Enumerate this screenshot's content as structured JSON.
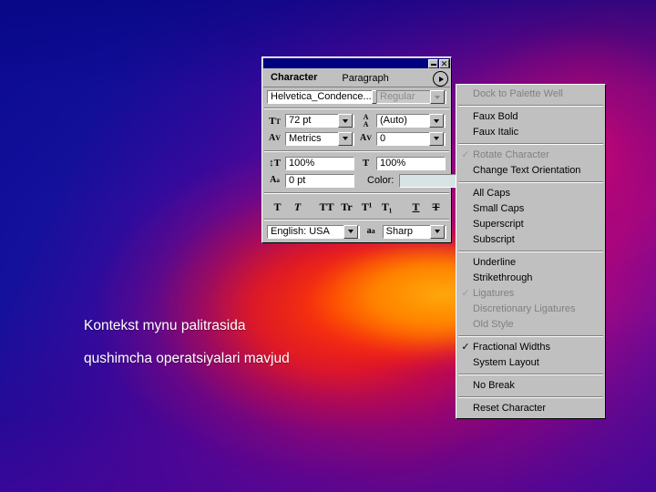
{
  "slide": {
    "line1": "Kontekst mynu palitrasida",
    "line2": "qushimcha operatsiyalari mavjud"
  },
  "palette": {
    "titlebar": {
      "minimize_label": "",
      "close_label": "✕"
    },
    "tabs": [
      {
        "label": "Character",
        "active": true
      },
      {
        "label": "Paragraph",
        "active": false
      }
    ],
    "menu_button": "palette-menu-triangle",
    "font": {
      "family_value": "Helvetica_Condence...",
      "style_value": "Regular",
      "style_disabled": true
    },
    "size": {
      "icon": "font-size-icon",
      "value": "72 pt"
    },
    "leading": {
      "icon": "leading-icon",
      "value": "(Auto)"
    },
    "kerning": {
      "icon": "kerning-icon",
      "value": "Metrics"
    },
    "tracking": {
      "icon": "tracking-icon",
      "value": "0"
    },
    "vertical_scale": {
      "icon": "vertical-scale-icon",
      "value": "100%"
    },
    "horizontal_scale": {
      "icon": "horizontal-scale-icon",
      "value": "100%"
    },
    "baseline_shift": {
      "icon": "baseline-shift-icon",
      "value": "0 pt"
    },
    "color": {
      "label": "Color:",
      "swatch_hex": "#d8e4e4"
    },
    "style_buttons": [
      {
        "name": "faux-bold-button",
        "glyph": "T",
        "style": "bold"
      },
      {
        "name": "faux-italic-button",
        "glyph": "T",
        "style": "italic"
      },
      {
        "name": "all-caps-button",
        "glyph": "TT",
        "style": "bold"
      },
      {
        "name": "small-caps-button",
        "glyph": "Tr",
        "style": "bold"
      },
      {
        "name": "superscript-button",
        "glyph": "T¹",
        "style": "bold"
      },
      {
        "name": "subscript-button",
        "glyph": "T₁",
        "style": "bold"
      },
      {
        "name": "underline-button",
        "glyph": "T",
        "style": "underline"
      },
      {
        "name": "strikethrough-button",
        "glyph": "T",
        "style": "strikethrough"
      }
    ],
    "language": {
      "value": "English: USA"
    },
    "antialias": {
      "icon": "anti-alias-icon",
      "value": "Sharp"
    }
  },
  "context_menu": {
    "items": [
      {
        "label": "Dock to Palette Well",
        "disabled": true,
        "checked": false,
        "name": "menu-item-dock-to-palette-well"
      },
      {
        "separator": true
      },
      {
        "label": "Faux Bold",
        "disabled": false,
        "checked": false,
        "name": "menu-item-faux-bold"
      },
      {
        "label": "Faux Italic",
        "disabled": false,
        "checked": false,
        "name": "menu-item-faux-italic"
      },
      {
        "separator": true
      },
      {
        "label": "Rotate Character",
        "disabled": true,
        "checked": true,
        "name": "menu-item-rotate-character"
      },
      {
        "label": "Change Text Orientation",
        "disabled": false,
        "checked": false,
        "name": "menu-item-change-text-orientation"
      },
      {
        "separator": true
      },
      {
        "label": "All Caps",
        "disabled": false,
        "checked": false,
        "name": "menu-item-all-caps"
      },
      {
        "label": "Small Caps",
        "disabled": false,
        "checked": false,
        "name": "menu-item-small-caps"
      },
      {
        "label": "Superscript",
        "disabled": false,
        "checked": false,
        "name": "menu-item-superscript"
      },
      {
        "label": "Subscript",
        "disabled": false,
        "checked": false,
        "name": "menu-item-subscript"
      },
      {
        "separator": true
      },
      {
        "label": "Underline",
        "disabled": false,
        "checked": false,
        "name": "menu-item-underline"
      },
      {
        "label": "Strikethrough",
        "disabled": false,
        "checked": false,
        "name": "menu-item-strikethrough"
      },
      {
        "label": "Ligatures",
        "disabled": true,
        "checked": true,
        "name": "menu-item-ligatures"
      },
      {
        "label": "Discretionary Ligatures",
        "disabled": true,
        "checked": false,
        "name": "menu-item-discretionary-ligatures"
      },
      {
        "label": "Old Style",
        "disabled": true,
        "checked": false,
        "name": "menu-item-old-style"
      },
      {
        "separator": true
      },
      {
        "label": "Fractional Widths",
        "disabled": false,
        "checked": true,
        "name": "menu-item-fractional-widths"
      },
      {
        "label": "System Layout",
        "disabled": false,
        "checked": false,
        "name": "menu-item-system-layout"
      },
      {
        "separator": true
      },
      {
        "label": "No Break",
        "disabled": false,
        "checked": false,
        "name": "menu-item-no-break"
      },
      {
        "separator": true
      },
      {
        "label": "Reset Character",
        "disabled": false,
        "checked": false,
        "name": "menu-item-reset-character"
      }
    ]
  }
}
